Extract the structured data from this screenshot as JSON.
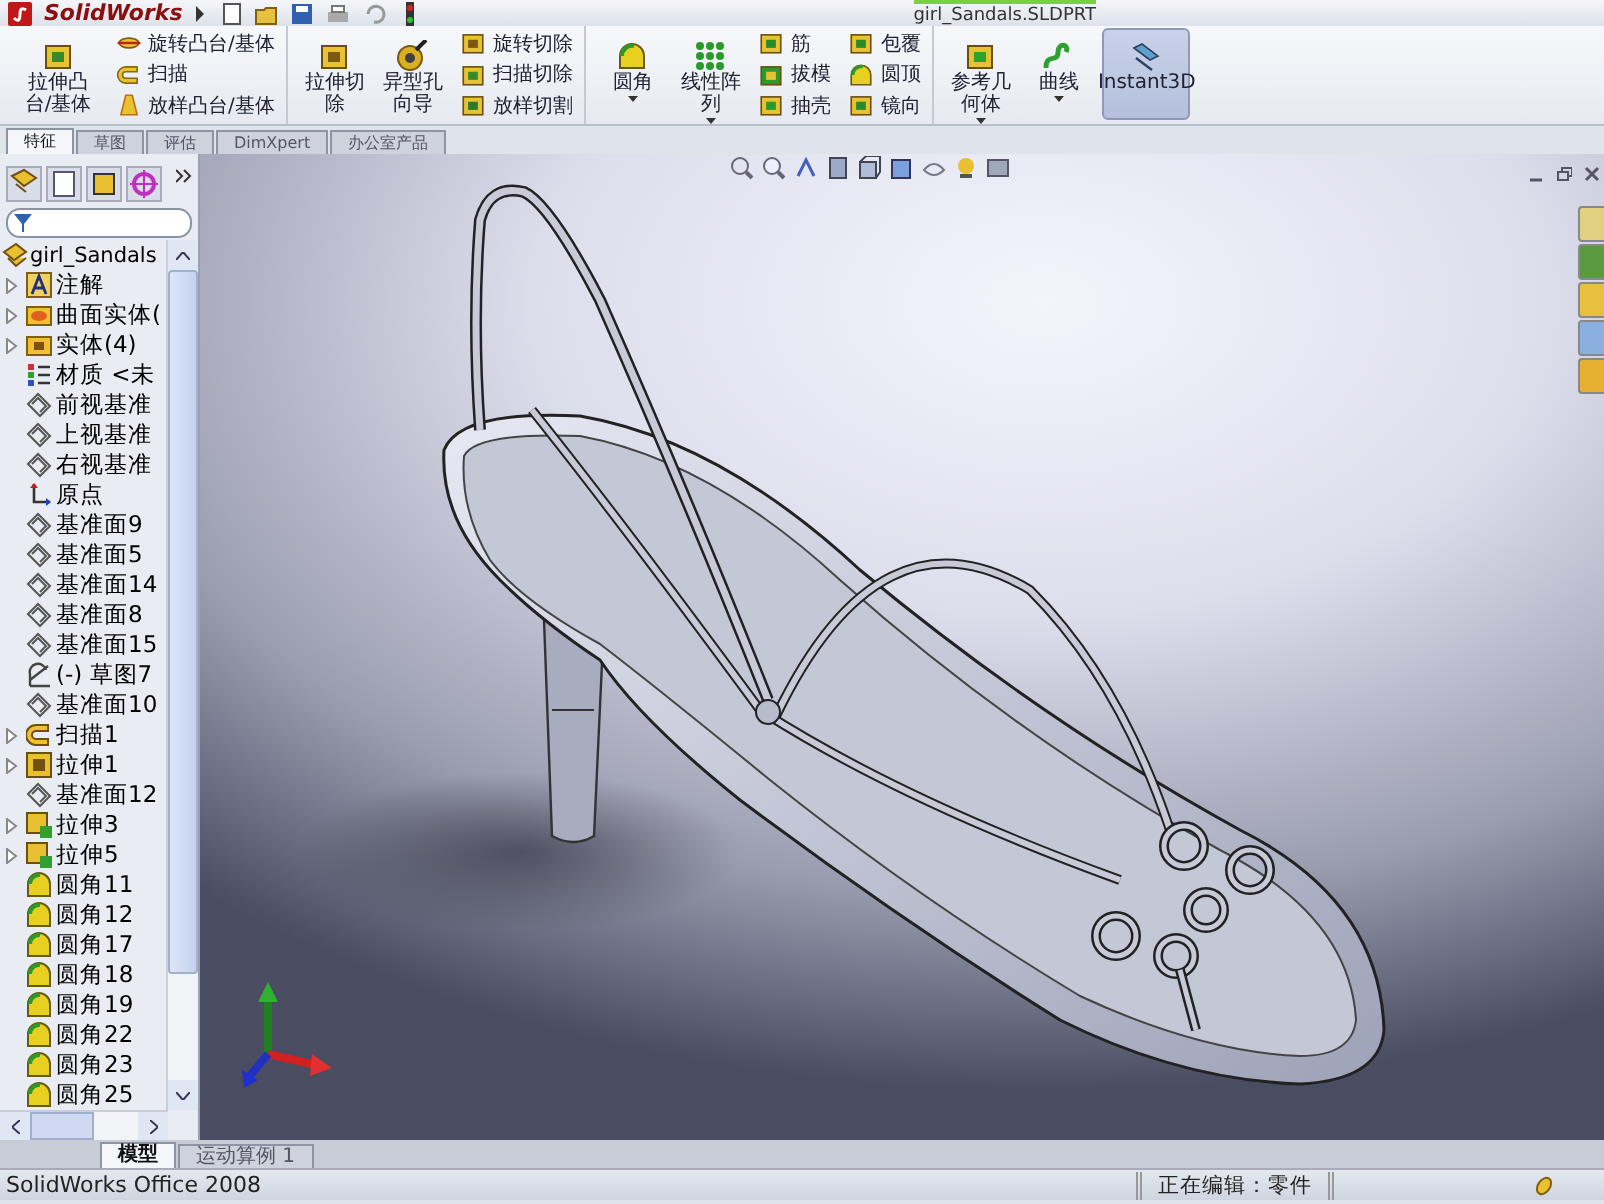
{
  "app": {
    "logo": "SolidWorks",
    "document_title": "girl_Sandals.SLDPRT"
  },
  "command_manager": {
    "groups": [
      {
        "items": [
          {
            "kind": "large",
            "label": "拉伸凸台/基体",
            "dropdown": false,
            "selected": false
          },
          {
            "kind": "stack",
            "entries": [
              {
                "label": "旋转凸台/基体"
              },
              {
                "label": "扫描"
              },
              {
                "label": "放样凸台/基体"
              }
            ]
          }
        ]
      },
      {
        "items": [
          {
            "kind": "large",
            "label": "拉伸切除",
            "dropdown": false,
            "selected": false
          },
          {
            "kind": "large",
            "label": "异型孔向导",
            "dropdown": false,
            "selected": false
          },
          {
            "kind": "stack",
            "entries": [
              {
                "label": "旋转切除"
              },
              {
                "label": "扫描切除"
              },
              {
                "label": "放样切割"
              }
            ]
          }
        ]
      },
      {
        "items": [
          {
            "kind": "large",
            "label": "圆角",
            "dropdown": true,
            "selected": false
          },
          {
            "kind": "large",
            "label": "线性阵列",
            "dropdown": true,
            "selected": false
          },
          {
            "kind": "stack",
            "entries": [
              {
                "label": "筋"
              },
              {
                "label": "拔模"
              },
              {
                "label": "抽壳"
              }
            ]
          },
          {
            "kind": "stack",
            "entries": [
              {
                "label": "包覆"
              },
              {
                "label": "圆顶"
              },
              {
                "label": "镜向"
              }
            ]
          }
        ]
      },
      {
        "items": [
          {
            "kind": "large",
            "label": "参考几何体",
            "dropdown": true,
            "selected": false
          },
          {
            "kind": "large",
            "label": "曲线",
            "dropdown": true,
            "selected": false
          },
          {
            "kind": "large",
            "label": "Instant3D",
            "dropdown": false,
            "selected": true
          }
        ]
      }
    ]
  },
  "tabs": [
    {
      "label": "特征",
      "selected": true
    },
    {
      "label": "草图",
      "selected": false
    },
    {
      "label": "评估",
      "selected": false
    },
    {
      "label": "DimXpert",
      "selected": false
    },
    {
      "label": "办公室产品",
      "selected": false
    }
  ],
  "feature_tree": {
    "root": "girl_Sandals",
    "items": [
      {
        "label": "注解",
        "kind": "annotation",
        "collapsed": true
      },
      {
        "label": "曲面实体(",
        "kind": "surface",
        "collapsed": true
      },
      {
        "label": "实体(4)",
        "kind": "solid",
        "collapsed": true
      },
      {
        "label": "材质 <未",
        "kind": "material",
        "collapsed": false
      },
      {
        "label": "前视基准",
        "kind": "plane",
        "collapsed": false
      },
      {
        "label": "上视基准",
        "kind": "plane",
        "collapsed": false
      },
      {
        "label": "右视基准",
        "kind": "plane",
        "collapsed": false
      },
      {
        "label": "原点",
        "kind": "origin",
        "collapsed": false
      },
      {
        "label": "基准面9",
        "kind": "plane",
        "collapsed": false
      },
      {
        "label": "基准面5",
        "kind": "plane",
        "collapsed": false
      },
      {
        "label": "基准面14",
        "kind": "plane",
        "collapsed": false
      },
      {
        "label": "基准面8",
        "kind": "plane",
        "collapsed": false
      },
      {
        "label": "基准面15",
        "kind": "plane",
        "collapsed": false
      },
      {
        "label": "(-) 草图7",
        "kind": "sketch",
        "collapsed": false
      },
      {
        "label": "基准面10",
        "kind": "plane",
        "collapsed": false
      },
      {
        "label": "扫描1",
        "kind": "sweep",
        "collapsed": true
      },
      {
        "label": "拉伸1",
        "kind": "extrude",
        "collapsed": true
      },
      {
        "label": "基准面12",
        "kind": "plane",
        "collapsed": false
      },
      {
        "label": "拉伸3",
        "kind": "boss",
        "collapsed": true
      },
      {
        "label": "拉伸5",
        "kind": "boss",
        "collapsed": true
      },
      {
        "label": "圆角11",
        "kind": "fillet",
        "collapsed": false
      },
      {
        "label": "圆角12",
        "kind": "fillet",
        "collapsed": false
      },
      {
        "label": "圆角17",
        "kind": "fillet",
        "collapsed": false
      },
      {
        "label": "圆角18",
        "kind": "fillet",
        "collapsed": false
      },
      {
        "label": "圆角19",
        "kind": "fillet",
        "collapsed": false
      },
      {
        "label": "圆角22",
        "kind": "fillet",
        "collapsed": false
      },
      {
        "label": "圆角23",
        "kind": "fillet",
        "collapsed": false
      },
      {
        "label": "圆角25",
        "kind": "fillet",
        "collapsed": false
      }
    ]
  },
  "bottom_tabs": [
    {
      "label": "模型",
      "selected": true
    },
    {
      "label": "运动算例 1",
      "selected": false
    }
  ],
  "status_bar": {
    "product": "SolidWorks Office 2008",
    "mode": "正在编辑：零件"
  }
}
